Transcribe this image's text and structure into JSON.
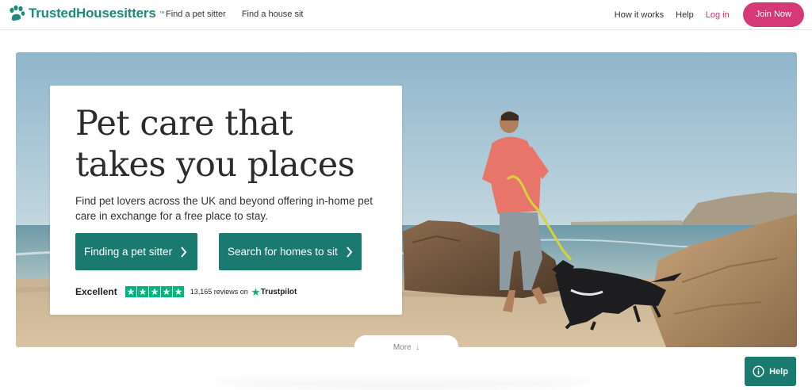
{
  "brand": {
    "name": "TrustedHousesitters",
    "trademark": "™",
    "color": "#1d8a7d"
  },
  "nav": {
    "left": [
      "Find a pet sitter",
      "Find a house sit"
    ],
    "right": [
      "How it works",
      "Help"
    ],
    "login": "Log in",
    "join": "Join Now"
  },
  "hero": {
    "title_line1": "Pet care that",
    "title_line2": "takes you places",
    "subtitle": "Find pet lovers across the UK and beyond offering in-home pet care in exchange for a free place to stay.",
    "primary_button": "Finding a pet sitter",
    "secondary_button": "Search for homes to sit",
    "button_icon": "chevron-right-icon"
  },
  "trustpilot": {
    "rating_label": "Excellent",
    "stars": 5,
    "reviews": "13,165 reviews on",
    "brand": "Trustpilot",
    "color": "#00b67a"
  },
  "more": {
    "label": "More",
    "icon": "arrow-down-icon"
  },
  "help": {
    "label": "Help",
    "icon": "info-icon"
  },
  "colors": {
    "accent": "#1a7a70",
    "join": "#d63978",
    "login": "#d62a73"
  }
}
